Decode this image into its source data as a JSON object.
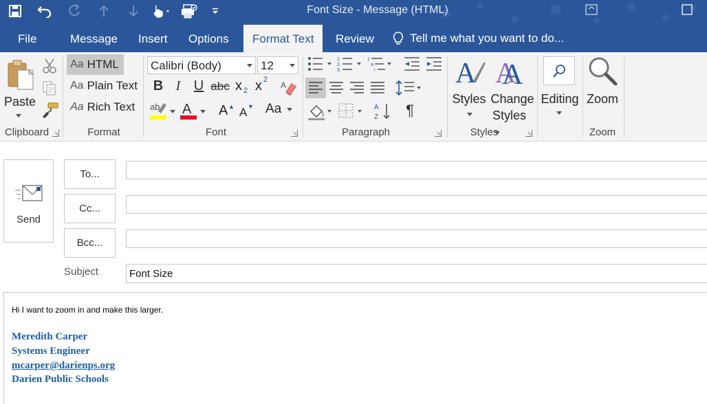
{
  "window": {
    "title": "Font Size - Message (HTML)",
    "accent_color": "#2b579a"
  },
  "quick_access": [
    {
      "icon": "save-icon"
    },
    {
      "icon": "undo-icon"
    },
    {
      "icon": "redo-icon"
    },
    {
      "icon": "previous-item-icon"
    },
    {
      "icon": "next-item-icon"
    },
    {
      "icon": "touch-mode-icon"
    },
    {
      "icon": "print-icon"
    },
    {
      "icon": "customize-qat-icon"
    }
  ],
  "tabs": [
    {
      "label": "File",
      "active": false
    },
    {
      "label": "Message",
      "active": false
    },
    {
      "label": "Insert",
      "active": false
    },
    {
      "label": "Options",
      "active": false
    },
    {
      "label": "Format Text",
      "active": true
    },
    {
      "label": "Review",
      "active": false
    }
  ],
  "tell_me": "Tell me what you want to do...",
  "ribbon": {
    "clipboard": {
      "label": "Clipboard",
      "paste": "Paste"
    },
    "format": {
      "label": "Format",
      "html": "HTML",
      "plain": "Plain Text",
      "rich": "Rich Text",
      "aa": "Aa"
    },
    "font": {
      "label": "Font",
      "font_name": "Calibri (Body)",
      "font_size": "12",
      "bold": "B",
      "italic": "I",
      "underline": "U",
      "strike": "abc",
      "subscript": "x",
      "sub_mark": "2",
      "superscript": "x",
      "sup_mark": "2",
      "grow": "A",
      "shrink": "A",
      "change_case": "Aa"
    },
    "paragraph": {
      "label": "Paragraph",
      "pilcrow": "¶"
    },
    "styles": {
      "label": "Styles",
      "styles_btn": "Styles",
      "change_line1": "Change",
      "change_line2": "Styles"
    },
    "editing": {
      "label": "Editing"
    },
    "zoom": {
      "label": "Zoom",
      "zoom_btn": "Zoom"
    }
  },
  "compose": {
    "send": "Send",
    "to": "To...",
    "cc": "Cc...",
    "bcc": "Bcc...",
    "to_value": "",
    "cc_value": "",
    "bcc_value": "",
    "subject_label": "Subject",
    "subject_value": "Font Size"
  },
  "body": {
    "text": "Hi I want to zoom in and make this larger.",
    "signature": {
      "name": "Meredith Carper",
      "title": "Systems Engineer",
      "email": "mcarper@darienps.org",
      "org": "Darien Public Schools",
      "color": "#1f5fa0"
    }
  }
}
